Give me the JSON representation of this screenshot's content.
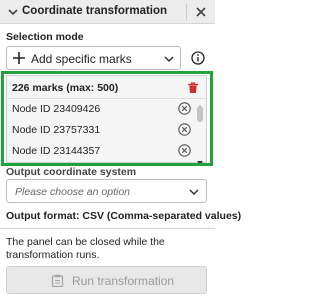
{
  "header": {
    "title": "Coordinate transformation",
    "collapse_icon": "chevron-down-icon",
    "close_icon": "close-icon"
  },
  "selection_mode": {
    "label": "Selection mode",
    "value": "Add specific marks",
    "value_icon": "plus-icon",
    "info_icon": "info-icon"
  },
  "marks": {
    "count_label": "226 marks (max: 500)",
    "clear_icon": "trash-icon",
    "items": [
      {
        "label": "Node ID 23409426"
      },
      {
        "label": "Node ID 23757331"
      },
      {
        "label": "Node ID 23144357"
      }
    ],
    "highlight_color": "#1fa33a"
  },
  "output_system": {
    "label": "Output coordinate system",
    "placeholder": "Please choose an option"
  },
  "output_format": {
    "label": "Output format: CSV (Comma-separated values)"
  },
  "note": "The panel can be closed while the transformation runs.",
  "run_button": {
    "label": "Run transformation",
    "icon": "clipboard-icon",
    "disabled": true
  }
}
